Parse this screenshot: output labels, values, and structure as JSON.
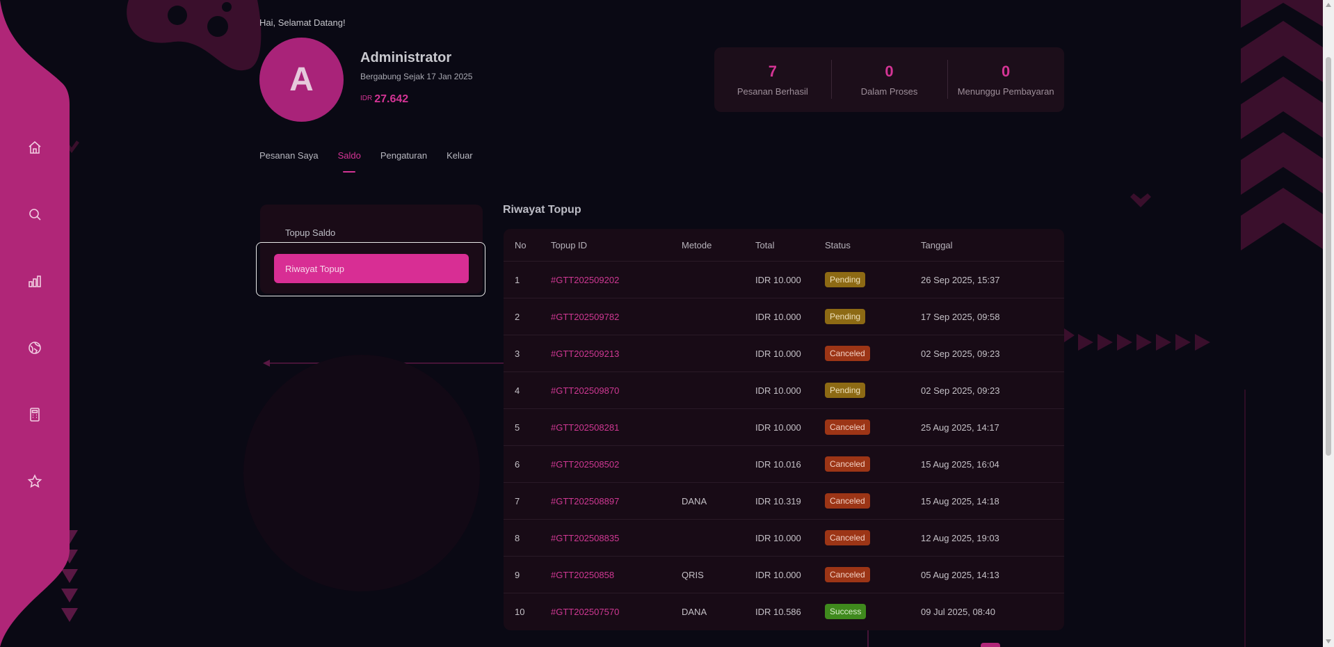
{
  "greeting": "Hai, Selamat Datang!",
  "profile": {
    "initial": "A",
    "name": "Administrator",
    "joined": "Bergabung Sejak 17 Jan 2025",
    "balance_currency": "IDR",
    "balance_amount": "27.642"
  },
  "stats": [
    {
      "value": "7",
      "label": "Pesanan Berhasil"
    },
    {
      "value": "0",
      "label": "Dalam Proses"
    },
    {
      "value": "0",
      "label": "Menunggu Pembayaran"
    }
  ],
  "tabs": [
    {
      "label": "Pesanan Saya",
      "active": false
    },
    {
      "label": "Saldo",
      "active": true
    },
    {
      "label": "Pengaturan",
      "active": false
    },
    {
      "label": "Keluar",
      "active": false
    }
  ],
  "sidenav_icons": [
    "home-icon",
    "search-icon",
    "chart-icon",
    "globe-icon",
    "calculator-icon",
    "star-icon"
  ],
  "side_menu": {
    "topup_label": "Topup Saldo",
    "history_label": "Riwayat Topup"
  },
  "history": {
    "title": "Riwayat Topup",
    "columns": [
      "No",
      "Topup ID",
      "Metode",
      "Total",
      "Status",
      "Tanggal"
    ],
    "rows": [
      {
        "no": "1",
        "id": "#GTT202509202",
        "method": "",
        "total": "IDR 10.000",
        "status": "Pending",
        "date": "26 Sep 2025, 15:37"
      },
      {
        "no": "2",
        "id": "#GTT202509782",
        "method": "",
        "total": "IDR 10.000",
        "status": "Pending",
        "date": "17 Sep 2025, 09:58"
      },
      {
        "no": "3",
        "id": "#GTT202509213",
        "method": "",
        "total": "IDR 10.000",
        "status": "Canceled",
        "date": "02 Sep 2025, 09:23"
      },
      {
        "no": "4",
        "id": "#GTT202509870",
        "method": "",
        "total": "IDR 10.000",
        "status": "Pending",
        "date": "02 Sep 2025, 09:23"
      },
      {
        "no": "5",
        "id": "#GTT202508281",
        "method": "",
        "total": "IDR 10.000",
        "status": "Canceled",
        "date": "25 Aug 2025, 14:17"
      },
      {
        "no": "6",
        "id": "#GTT202508502",
        "method": "",
        "total": "IDR 10.016",
        "status": "Canceled",
        "date": "15 Aug 2025, 16:04"
      },
      {
        "no": "7",
        "id": "#GTT202508897",
        "method": "DANA",
        "total": "IDR 10.319",
        "status": "Canceled",
        "date": "15 Aug 2025, 14:18"
      },
      {
        "no": "8",
        "id": "#GTT202508835",
        "method": "",
        "total": "IDR 10.000",
        "status": "Canceled",
        "date": "12 Aug 2025, 19:03"
      },
      {
        "no": "9",
        "id": "#GTT20250858",
        "method": "QRIS",
        "total": "IDR 10.000",
        "status": "Canceled",
        "date": "05 Aug 2025, 14:13"
      },
      {
        "no": "10",
        "id": "#GTT202507570",
        "method": "DANA",
        "total": "IDR 10.586",
        "status": "Success",
        "date": "09 Jul 2025, 08:40"
      }
    ]
  },
  "colors": {
    "accent": "#d43495",
    "background": "#0a0914",
    "pending": "#8d6a14",
    "canceled": "#9c3516",
    "success": "#3f8a1d"
  }
}
